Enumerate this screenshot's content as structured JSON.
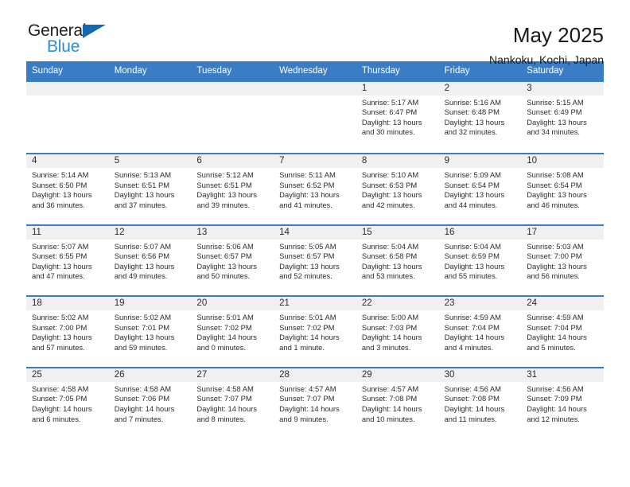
{
  "logo": {
    "word_top": "General",
    "word_bottom": "Blue",
    "flag_icon": "triangle-flag-icon",
    "color_dark": "#231f20",
    "color_blue": "#2b8bd4",
    "flag_color": "#1567b2"
  },
  "header": {
    "title": "May 2025",
    "subtitle": "Nankoku, Kochi, Japan"
  },
  "theme": {
    "header_bg": "#3b7dc4",
    "header_text": "#ffffff",
    "datestrip_bg": "#f0f0f0",
    "cell_bg": "#ffffff"
  },
  "weekdays": [
    "Sunday",
    "Monday",
    "Tuesday",
    "Wednesday",
    "Thursday",
    "Friday",
    "Saturday"
  ],
  "weeks": [
    [
      {
        "date": "",
        "empty": true,
        "sunrise": "",
        "sunset": "",
        "daylight_line1": "",
        "daylight_line2": ""
      },
      {
        "date": "",
        "empty": true,
        "sunrise": "",
        "sunset": "",
        "daylight_line1": "",
        "daylight_line2": ""
      },
      {
        "date": "",
        "empty": true,
        "sunrise": "",
        "sunset": "",
        "daylight_line1": "",
        "daylight_line2": ""
      },
      {
        "date": "",
        "empty": true,
        "sunrise": "",
        "sunset": "",
        "daylight_line1": "",
        "daylight_line2": ""
      },
      {
        "date": "1",
        "empty": false,
        "sunrise": "Sunrise: 5:17 AM",
        "sunset": "Sunset: 6:47 PM",
        "daylight_line1": "Daylight: 13 hours",
        "daylight_line2": "and 30 minutes."
      },
      {
        "date": "2",
        "empty": false,
        "sunrise": "Sunrise: 5:16 AM",
        "sunset": "Sunset: 6:48 PM",
        "daylight_line1": "Daylight: 13 hours",
        "daylight_line2": "and 32 minutes."
      },
      {
        "date": "3",
        "empty": false,
        "sunrise": "Sunrise: 5:15 AM",
        "sunset": "Sunset: 6:49 PM",
        "daylight_line1": "Daylight: 13 hours",
        "daylight_line2": "and 34 minutes."
      }
    ],
    [
      {
        "date": "4",
        "empty": false,
        "sunrise": "Sunrise: 5:14 AM",
        "sunset": "Sunset: 6:50 PM",
        "daylight_line1": "Daylight: 13 hours",
        "daylight_line2": "and 36 minutes."
      },
      {
        "date": "5",
        "empty": false,
        "sunrise": "Sunrise: 5:13 AM",
        "sunset": "Sunset: 6:51 PM",
        "daylight_line1": "Daylight: 13 hours",
        "daylight_line2": "and 37 minutes."
      },
      {
        "date": "6",
        "empty": false,
        "sunrise": "Sunrise: 5:12 AM",
        "sunset": "Sunset: 6:51 PM",
        "daylight_line1": "Daylight: 13 hours",
        "daylight_line2": "and 39 minutes."
      },
      {
        "date": "7",
        "empty": false,
        "sunrise": "Sunrise: 5:11 AM",
        "sunset": "Sunset: 6:52 PM",
        "daylight_line1": "Daylight: 13 hours",
        "daylight_line2": "and 41 minutes."
      },
      {
        "date": "8",
        "empty": false,
        "sunrise": "Sunrise: 5:10 AM",
        "sunset": "Sunset: 6:53 PM",
        "daylight_line1": "Daylight: 13 hours",
        "daylight_line2": "and 42 minutes."
      },
      {
        "date": "9",
        "empty": false,
        "sunrise": "Sunrise: 5:09 AM",
        "sunset": "Sunset: 6:54 PM",
        "daylight_line1": "Daylight: 13 hours",
        "daylight_line2": "and 44 minutes."
      },
      {
        "date": "10",
        "empty": false,
        "sunrise": "Sunrise: 5:08 AM",
        "sunset": "Sunset: 6:54 PM",
        "daylight_line1": "Daylight: 13 hours",
        "daylight_line2": "and 46 minutes."
      }
    ],
    [
      {
        "date": "11",
        "empty": false,
        "sunrise": "Sunrise: 5:07 AM",
        "sunset": "Sunset: 6:55 PM",
        "daylight_line1": "Daylight: 13 hours",
        "daylight_line2": "and 47 minutes."
      },
      {
        "date": "12",
        "empty": false,
        "sunrise": "Sunrise: 5:07 AM",
        "sunset": "Sunset: 6:56 PM",
        "daylight_line1": "Daylight: 13 hours",
        "daylight_line2": "and 49 minutes."
      },
      {
        "date": "13",
        "empty": false,
        "sunrise": "Sunrise: 5:06 AM",
        "sunset": "Sunset: 6:57 PM",
        "daylight_line1": "Daylight: 13 hours",
        "daylight_line2": "and 50 minutes."
      },
      {
        "date": "14",
        "empty": false,
        "sunrise": "Sunrise: 5:05 AM",
        "sunset": "Sunset: 6:57 PM",
        "daylight_line1": "Daylight: 13 hours",
        "daylight_line2": "and 52 minutes."
      },
      {
        "date": "15",
        "empty": false,
        "sunrise": "Sunrise: 5:04 AM",
        "sunset": "Sunset: 6:58 PM",
        "daylight_line1": "Daylight: 13 hours",
        "daylight_line2": "and 53 minutes."
      },
      {
        "date": "16",
        "empty": false,
        "sunrise": "Sunrise: 5:04 AM",
        "sunset": "Sunset: 6:59 PM",
        "daylight_line1": "Daylight: 13 hours",
        "daylight_line2": "and 55 minutes."
      },
      {
        "date": "17",
        "empty": false,
        "sunrise": "Sunrise: 5:03 AM",
        "sunset": "Sunset: 7:00 PM",
        "daylight_line1": "Daylight: 13 hours",
        "daylight_line2": "and 56 minutes."
      }
    ],
    [
      {
        "date": "18",
        "empty": false,
        "sunrise": "Sunrise: 5:02 AM",
        "sunset": "Sunset: 7:00 PM",
        "daylight_line1": "Daylight: 13 hours",
        "daylight_line2": "and 57 minutes."
      },
      {
        "date": "19",
        "empty": false,
        "sunrise": "Sunrise: 5:02 AM",
        "sunset": "Sunset: 7:01 PM",
        "daylight_line1": "Daylight: 13 hours",
        "daylight_line2": "and 59 minutes."
      },
      {
        "date": "20",
        "empty": false,
        "sunrise": "Sunrise: 5:01 AM",
        "sunset": "Sunset: 7:02 PM",
        "daylight_line1": "Daylight: 14 hours",
        "daylight_line2": "and 0 minutes."
      },
      {
        "date": "21",
        "empty": false,
        "sunrise": "Sunrise: 5:01 AM",
        "sunset": "Sunset: 7:02 PM",
        "daylight_line1": "Daylight: 14 hours",
        "daylight_line2": "and 1 minute."
      },
      {
        "date": "22",
        "empty": false,
        "sunrise": "Sunrise: 5:00 AM",
        "sunset": "Sunset: 7:03 PM",
        "daylight_line1": "Daylight: 14 hours",
        "daylight_line2": "and 3 minutes."
      },
      {
        "date": "23",
        "empty": false,
        "sunrise": "Sunrise: 4:59 AM",
        "sunset": "Sunset: 7:04 PM",
        "daylight_line1": "Daylight: 14 hours",
        "daylight_line2": "and 4 minutes."
      },
      {
        "date": "24",
        "empty": false,
        "sunrise": "Sunrise: 4:59 AM",
        "sunset": "Sunset: 7:04 PM",
        "daylight_line1": "Daylight: 14 hours",
        "daylight_line2": "and 5 minutes."
      }
    ],
    [
      {
        "date": "25",
        "empty": false,
        "sunrise": "Sunrise: 4:58 AM",
        "sunset": "Sunset: 7:05 PM",
        "daylight_line1": "Daylight: 14 hours",
        "daylight_line2": "and 6 minutes."
      },
      {
        "date": "26",
        "empty": false,
        "sunrise": "Sunrise: 4:58 AM",
        "sunset": "Sunset: 7:06 PM",
        "daylight_line1": "Daylight: 14 hours",
        "daylight_line2": "and 7 minutes."
      },
      {
        "date": "27",
        "empty": false,
        "sunrise": "Sunrise: 4:58 AM",
        "sunset": "Sunset: 7:07 PM",
        "daylight_line1": "Daylight: 14 hours",
        "daylight_line2": "and 8 minutes."
      },
      {
        "date": "28",
        "empty": false,
        "sunrise": "Sunrise: 4:57 AM",
        "sunset": "Sunset: 7:07 PM",
        "daylight_line1": "Daylight: 14 hours",
        "daylight_line2": "and 9 minutes."
      },
      {
        "date": "29",
        "empty": false,
        "sunrise": "Sunrise: 4:57 AM",
        "sunset": "Sunset: 7:08 PM",
        "daylight_line1": "Daylight: 14 hours",
        "daylight_line2": "and 10 minutes."
      },
      {
        "date": "30",
        "empty": false,
        "sunrise": "Sunrise: 4:56 AM",
        "sunset": "Sunset: 7:08 PM",
        "daylight_line1": "Daylight: 14 hours",
        "daylight_line2": "and 11 minutes."
      },
      {
        "date": "31",
        "empty": false,
        "sunrise": "Sunrise: 4:56 AM",
        "sunset": "Sunset: 7:09 PM",
        "daylight_line1": "Daylight: 14 hours",
        "daylight_line2": "and 12 minutes."
      }
    ]
  ]
}
